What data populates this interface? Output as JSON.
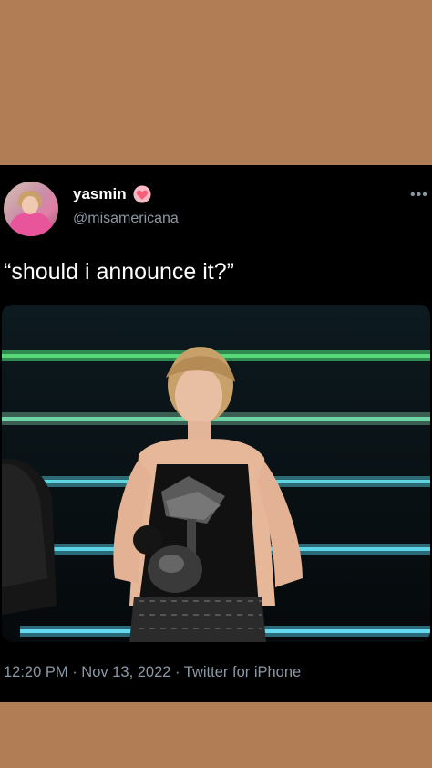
{
  "tweet": {
    "display_name": "yasmin",
    "handle": "@misamericana",
    "text": "“should i announce it?”",
    "timestamp": "12:20 PM · Nov 13, 2022 · Twitter for iPhone"
  },
  "icons": {
    "name_badge": "heart-icon",
    "menu": "more-icon"
  },
  "colors": {
    "page_background": "#b07d55",
    "card_background": "#000000",
    "secondary_text": "#8b98a5",
    "heart": "#f4607a"
  },
  "media": {
    "description_icon": "photo"
  }
}
